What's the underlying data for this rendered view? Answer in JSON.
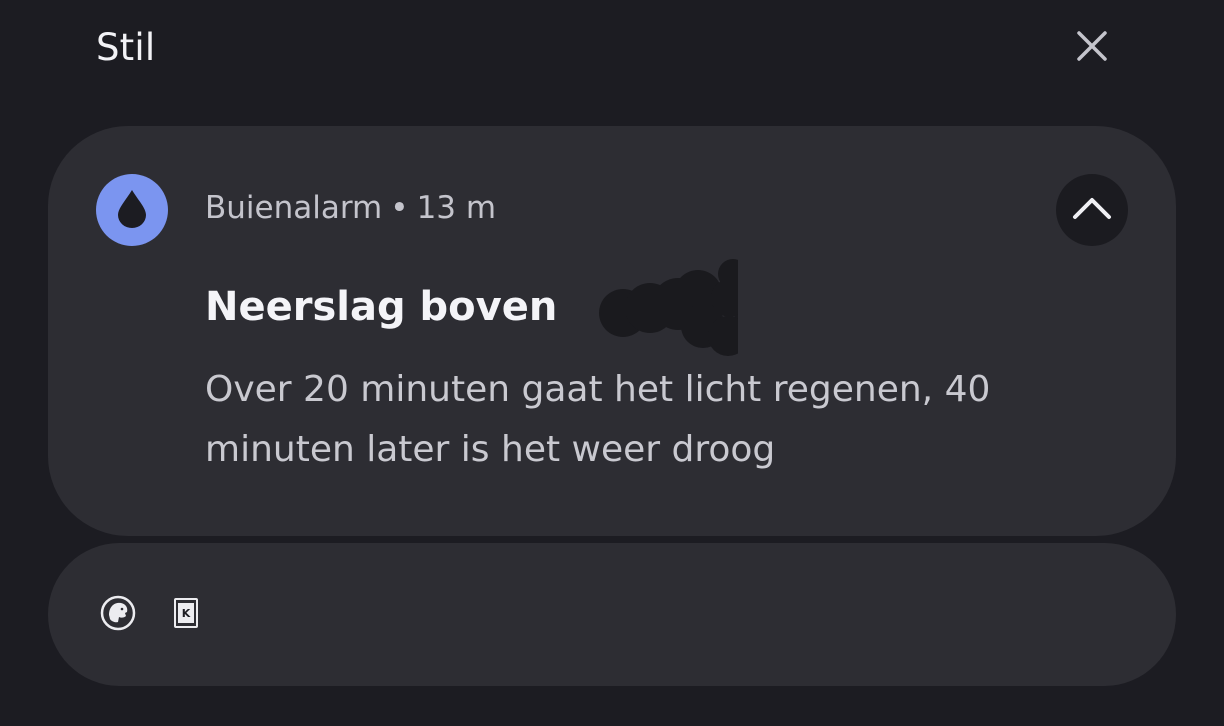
{
  "section": {
    "title": "Stil",
    "close_icon": "close-icon"
  },
  "notification": {
    "app_name": "Buienalarm",
    "separator": "•",
    "time": "13 m",
    "app_icon": "water-drop-icon",
    "expand_icon": "chevron-up-icon",
    "title": "Neerslag boven",
    "body": "Over 20 minuten gaat het licht regenen, 40 minuten later is het weer droog",
    "accent_color": "#7b95f0"
  },
  "collapsed_group": {
    "icons": [
      "app-icon-lion",
      "app-icon-k"
    ]
  },
  "colors": {
    "background": "#1c1c22",
    "card": "#2d2d33"
  }
}
